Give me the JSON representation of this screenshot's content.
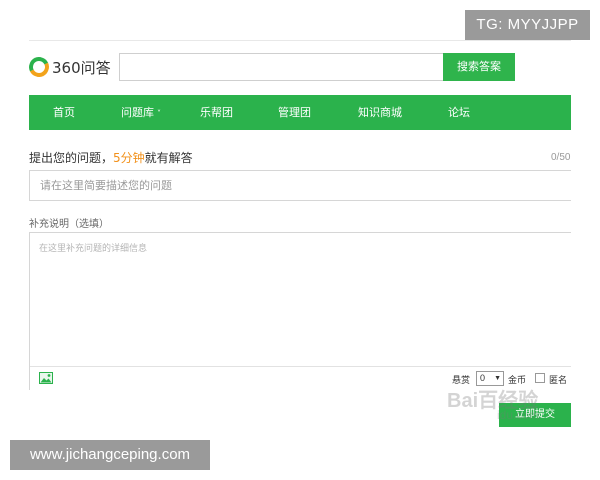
{
  "overlay": {
    "tg_label": "TG: MYYJJPP",
    "site_label": "www.jichangceping.com",
    "watermark_main": "Bai百经验",
    "watermark_sub": "idu.com"
  },
  "header": {
    "logo_text": "360问答",
    "logo_icon": "logo-ring-icon",
    "search_placeholder": "",
    "search_button": "搜索答案"
  },
  "nav": {
    "items": [
      {
        "label": "首页"
      },
      {
        "label": "问题库",
        "caret": "˅"
      },
      {
        "label": "乐帮团"
      },
      {
        "label": "管理团"
      },
      {
        "label": "知识商城"
      },
      {
        "label": "论坛"
      }
    ]
  },
  "ask": {
    "title_prefix": "提出您的问题，",
    "title_highlight": "5分钟",
    "title_suffix": "就有解答",
    "char_count": "0/50",
    "question_placeholder": "请在这里简要描述您的问题",
    "supplement_label": "补充说明（选填）",
    "detail_placeholder": "在这里补充问题的详细信息",
    "image_icon": "image-icon",
    "reward_label": "悬赏",
    "reward_value": "0",
    "reward_caret": "▼",
    "coin_label": "金币",
    "anonymous_label": "匿名",
    "submit_label": "立即提交"
  },
  "colors": {
    "brand_green": "#2bb24c",
    "highlight_orange": "#f2911b"
  }
}
